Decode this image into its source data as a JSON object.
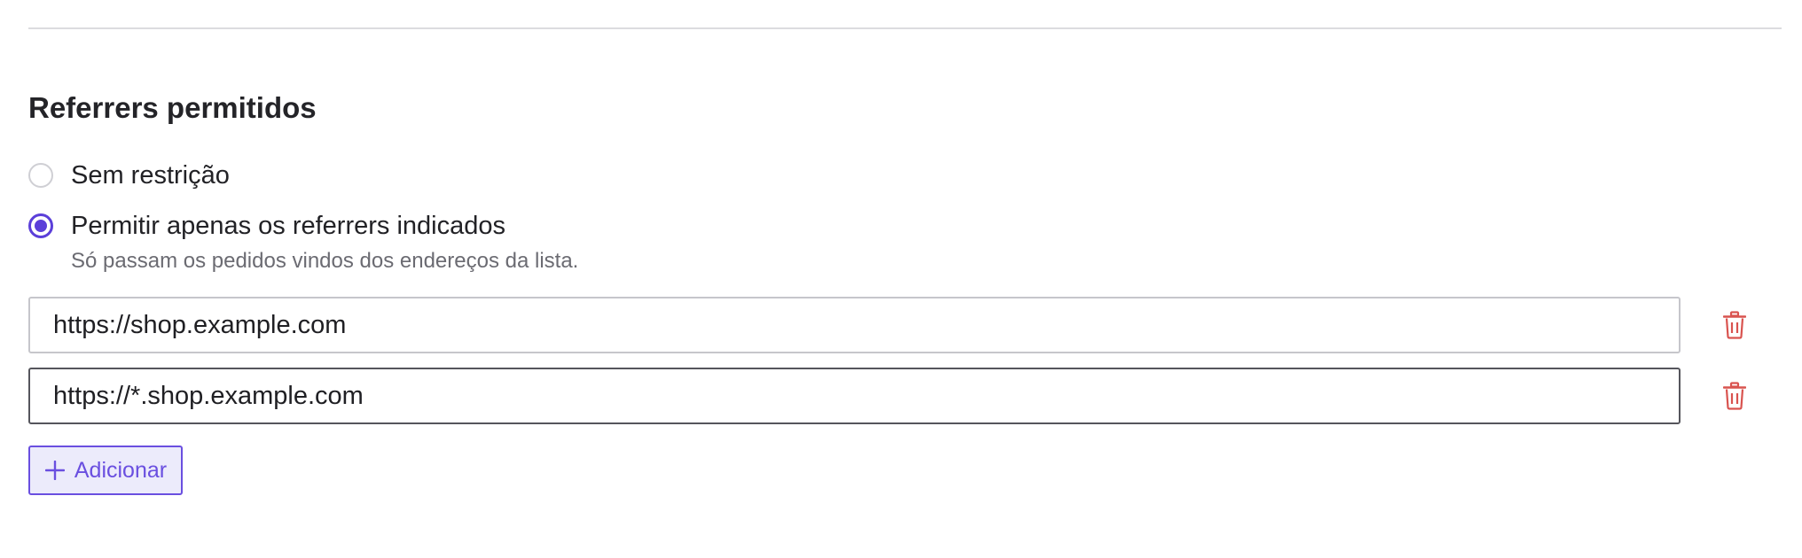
{
  "section": {
    "title": "Referrers permitidos"
  },
  "restriction": {
    "options": [
      {
        "label": "Sem restrição",
        "selected": false
      },
      {
        "label": "Permitir apenas os referrers indicados",
        "selected": true
      }
    ],
    "hint": "Só passam os pedidos vindos dos endereços da lista."
  },
  "referrers": [
    {
      "value": "https://shop.example.com",
      "focused": false
    },
    {
      "value": "https://*.shop.example.com",
      "focused": true
    }
  ],
  "actions": {
    "add_label": "Adicionar"
  },
  "icons": {
    "delete": "trash-icon",
    "add": "plus-icon"
  },
  "colors": {
    "accent": "#5b3fd9",
    "add_background": "#ecebfb",
    "delete": "#d9534f",
    "divider": "#dcdcdf"
  }
}
